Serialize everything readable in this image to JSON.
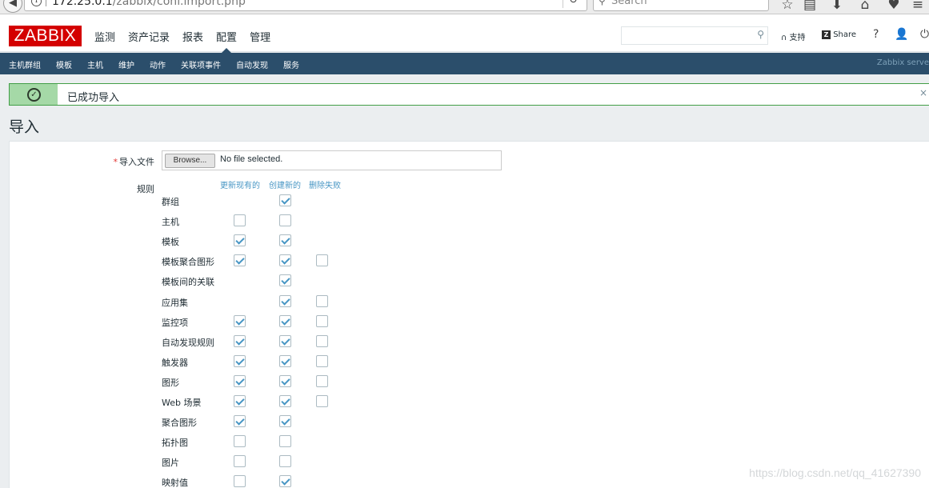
{
  "browser": {
    "url_host": "172.25.0.1",
    "url_path": "/zabbix/conf.import.php",
    "search_placeholder": "Search"
  },
  "header": {
    "logo": "ZABBIX",
    "menu": [
      "监测",
      "资产记录",
      "报表",
      "配置",
      "管理"
    ],
    "active_menu": "配置",
    "support_label": "支持",
    "share_label": "Share",
    "help_label": "?"
  },
  "submenu": {
    "items": [
      "主机群组",
      "模板",
      "主机",
      "维护",
      "动作",
      "关联项事件",
      "自动发现",
      "服务"
    ],
    "server_name": "Zabbix serve"
  },
  "message": {
    "text": "已成功导入",
    "close": "×"
  },
  "page": {
    "title": "导入"
  },
  "form": {
    "import_file_label": "导入文件",
    "browse_label": "Browse...",
    "file_status": "No file selected.",
    "rules_label": "规则",
    "columns": [
      "更新现有的",
      "创建新的",
      "删除失败"
    ],
    "rules": [
      {
        "name": "群组",
        "update": null,
        "create": true,
        "delete": null
      },
      {
        "name": "主机",
        "update": false,
        "create": false,
        "delete": null
      },
      {
        "name": "模板",
        "update": true,
        "create": true,
        "delete": null
      },
      {
        "name": "模板聚合图形",
        "update": true,
        "create": true,
        "delete": false
      },
      {
        "name": "模板间的关联",
        "update": null,
        "create": true,
        "delete": null
      },
      {
        "name": "应用集",
        "update": null,
        "create": true,
        "delete": false
      },
      {
        "name": "监控项",
        "update": true,
        "create": true,
        "delete": false
      },
      {
        "name": "自动发现规则",
        "update": true,
        "create": true,
        "delete": false
      },
      {
        "name": "触发器",
        "update": true,
        "create": true,
        "delete": false
      },
      {
        "name": "图形",
        "update": true,
        "create": true,
        "delete": false
      },
      {
        "name": "Web 场景",
        "update": true,
        "create": true,
        "delete": false
      },
      {
        "name": "聚合图形",
        "update": true,
        "create": true,
        "delete": null
      },
      {
        "name": "拓扑图",
        "update": false,
        "create": false,
        "delete": null
      },
      {
        "name": "图片",
        "update": false,
        "create": false,
        "delete": null
      },
      {
        "name": "映射值",
        "update": false,
        "create": true,
        "delete": null
      }
    ]
  },
  "watermark": "https://blog.csdn.net/qq_41627390",
  "colors": {
    "brand_red": "#d40000",
    "submenu_bg": "#2b4e6b",
    "success_border": "#429e47",
    "success_icon_bg": "#a5d9a7",
    "checkbox_accent": "#4796c4"
  }
}
